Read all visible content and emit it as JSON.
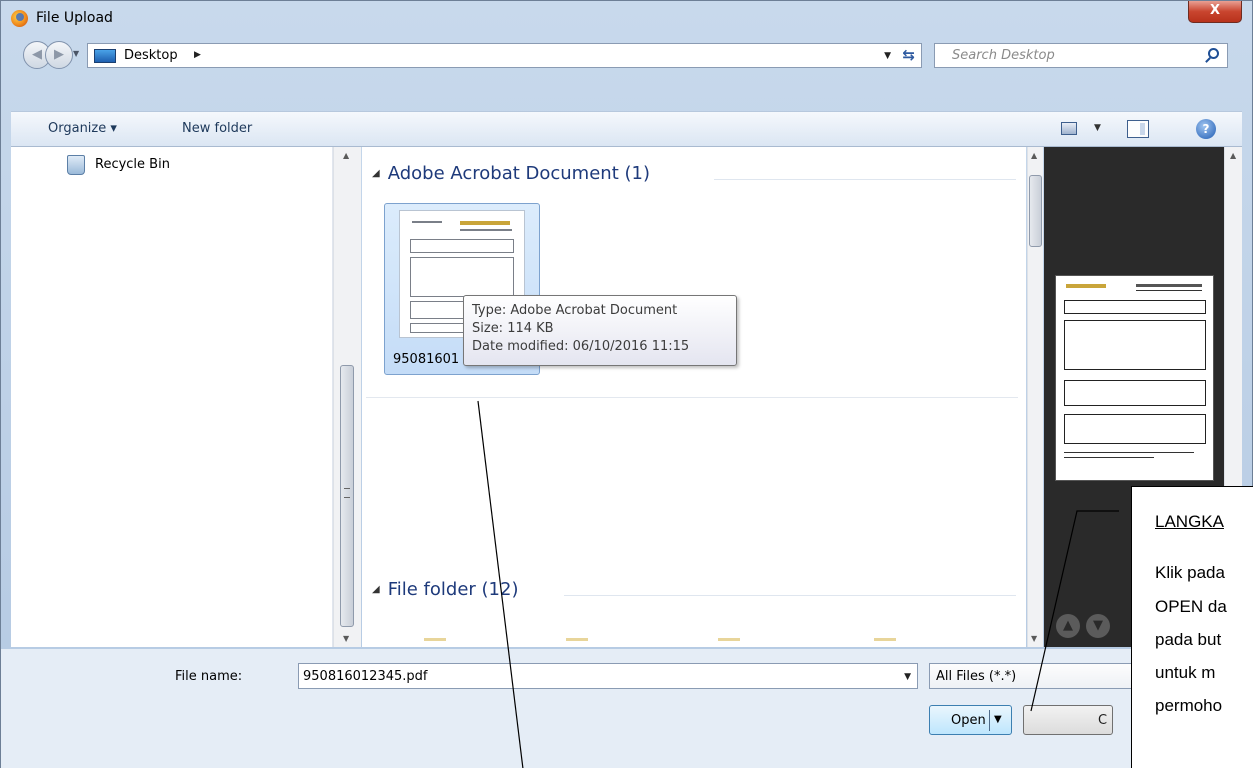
{
  "window": {
    "title": "File Upload",
    "close_glyph": "X"
  },
  "address": {
    "location": "Desktop",
    "search_placeholder": "Search Desktop"
  },
  "toolbar": {
    "organize": "Organize ▾",
    "new_folder": "New folder"
  },
  "nav_pane": {
    "items": [
      {
        "label": "Recycle Bin",
        "icon": "recycle-bin-icon"
      }
    ]
  },
  "file_list": {
    "groups": [
      {
        "header": "Adobe Acrobat Document (1)"
      },
      {
        "header": "File folder (12)"
      }
    ],
    "selected_file": {
      "name": "95081601"
    },
    "tooltip": {
      "type": "Type: Adobe Acrobat Document",
      "size": "Size: 114 KB",
      "date": "Date modified: 06/10/2016 11:15"
    }
  },
  "bottom": {
    "file_name_label": "File name:",
    "file_name_value": "950816012345.pdf",
    "filter_value": "All Files (*.*)",
    "open_label": "Open",
    "cancel_label": "C"
  },
  "annotation": {
    "heading": "LANGKA",
    "lines": [
      "Klik pada",
      "OPEN da",
      "pada but",
      "untuk m",
      "permoho"
    ]
  },
  "colors": {
    "frame": "#b4c9e2",
    "group_header": "#1e3a7b",
    "selection": "#c4dcf7",
    "close_button": "#c9452f"
  }
}
